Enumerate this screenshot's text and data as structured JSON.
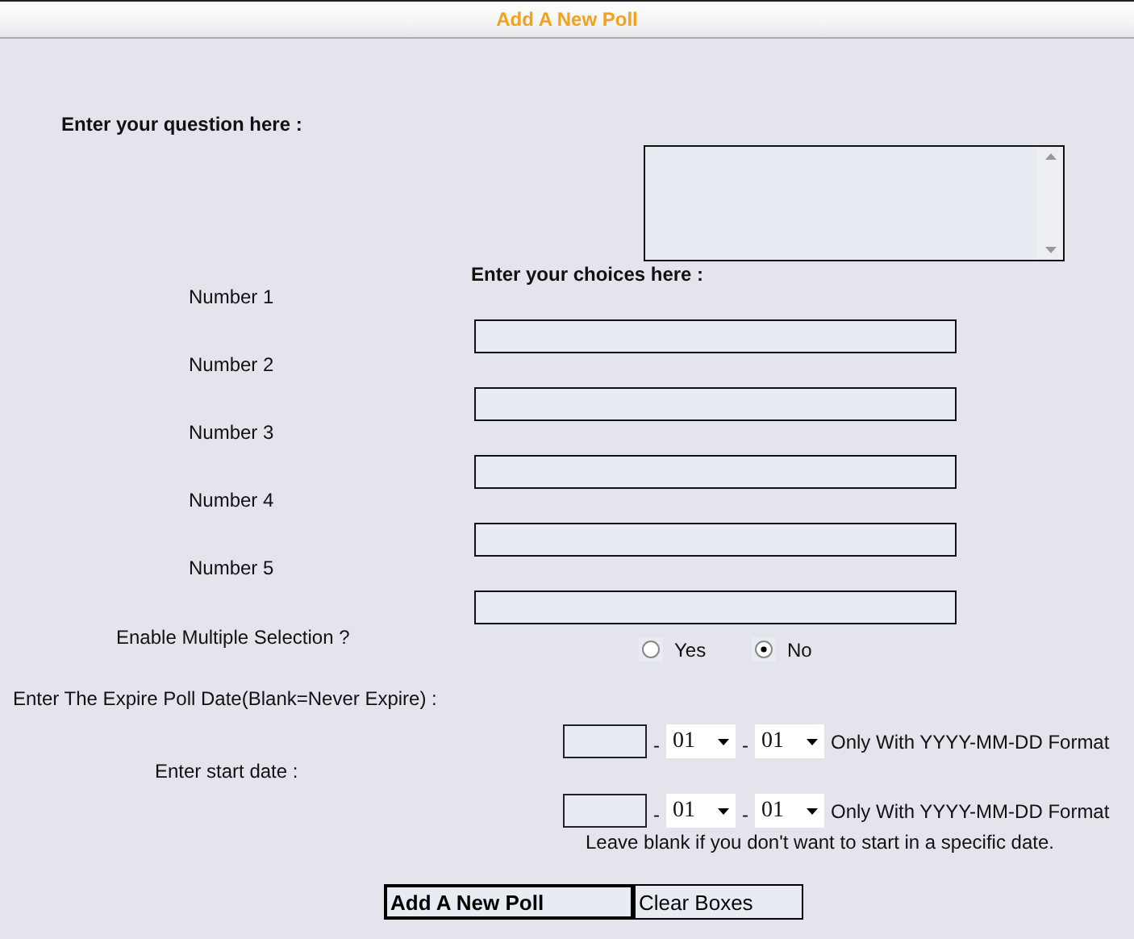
{
  "header": {
    "title": "Add A New Poll"
  },
  "question": {
    "label": "Enter your question here  :"
  },
  "choices": {
    "heading": "Enter your choices here :",
    "items": [
      {
        "label": "Number 1"
      },
      {
        "label": "Number 2"
      },
      {
        "label": "Number 3"
      },
      {
        "label": "Number 4"
      },
      {
        "label": "Number 5"
      }
    ]
  },
  "multiple_selection": {
    "label": "Enable Multiple Selection ?",
    "options": [
      {
        "label": "Yes",
        "selected": false
      },
      {
        "label": "No",
        "selected": true
      }
    ]
  },
  "expire_date": {
    "label": "Enter The Expire Poll Date(Blank=Never Expire) :",
    "separator": "-",
    "month": "01",
    "day": "01",
    "hint": "Only With YYYY-MM-DD Format"
  },
  "start_date": {
    "label": "Enter start date :",
    "separator": "-",
    "month": "01",
    "day": "01",
    "hint": "Only With YYYY-MM-DD Format",
    "note": "Leave blank if you don't want to start in a specific date."
  },
  "buttons": [
    {
      "label": "Add A New Poll",
      "kind": "primary"
    },
    {
      "label": "Clear Boxes",
      "kind": "secondary"
    }
  ]
}
